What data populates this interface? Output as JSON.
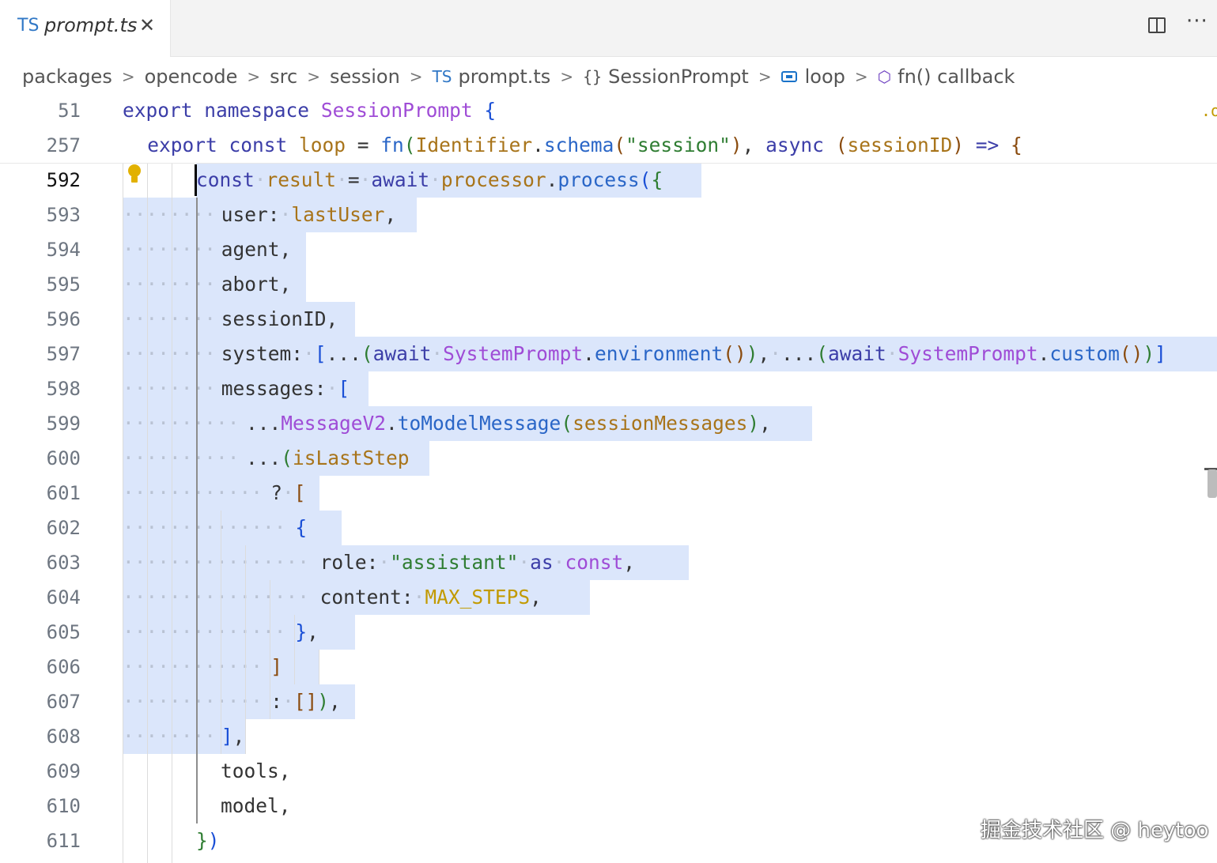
{
  "tab": {
    "lang_badge": "TS",
    "file_name": "prompt.ts",
    "close_glyph": "✕"
  },
  "toolbar": {
    "split_icon": "split-editor-icon",
    "more_glyph": "···"
  },
  "breadcrumb": {
    "items": [
      "packages",
      "opencode",
      "src",
      "session",
      "prompt.ts",
      "SessionPrompt",
      "loop",
      "fn() callback"
    ],
    "ts_badge": "TS",
    "braces_glyph": "{}"
  },
  "sticky": [
    {
      "line_number": "51",
      "tokens": [
        [
          "kw",
          "export"
        ],
        [
          "pn",
          " "
        ],
        [
          "kw",
          "namespace"
        ],
        [
          "pn",
          " "
        ],
        [
          "ty",
          "SessionPrompt"
        ],
        [
          "pn",
          " "
        ],
        [
          "b1",
          "{"
        ]
      ]
    },
    {
      "line_number": "257",
      "tokens": [
        [
          "kw",
          "export"
        ],
        [
          "pn",
          " "
        ],
        [
          "kw",
          "const"
        ],
        [
          "pn",
          " "
        ],
        [
          "va",
          "loop"
        ],
        [
          "pn",
          " = "
        ],
        [
          "fn",
          "fn"
        ],
        [
          "b2",
          "("
        ],
        [
          "va",
          "Identifier"
        ],
        [
          "pn",
          "."
        ],
        [
          "fn",
          "schema"
        ],
        [
          "b3",
          "("
        ],
        [
          "st",
          "\"session\""
        ],
        [
          "b3",
          ")"
        ],
        [
          "pn",
          ", "
        ],
        [
          "kw",
          "async"
        ],
        [
          "pn",
          " "
        ],
        [
          "b3",
          "("
        ],
        [
          "pa",
          "sessionID"
        ],
        [
          "b3",
          ")"
        ],
        [
          "pn",
          " "
        ],
        [
          "kw",
          "=>"
        ],
        [
          "pn",
          " "
        ],
        [
          "b3",
          "{"
        ]
      ]
    }
  ],
  "lines": [
    {
      "line_number": "592",
      "active": true,
      "tokens": [
        [
          "kw",
          "const"
        ],
        [
          "dot",
          "·"
        ],
        [
          "va",
          "result"
        ],
        [
          "dot",
          "·"
        ],
        [
          "pn",
          "="
        ],
        [
          "dot",
          "·"
        ],
        [
          "kw",
          "await"
        ],
        [
          "dot",
          "·"
        ],
        [
          "va",
          "processor"
        ],
        [
          "pn",
          "."
        ],
        [
          "fn",
          "process"
        ],
        [
          "b1",
          "("
        ],
        [
          "b2",
          "{"
        ]
      ]
    },
    {
      "line_number": "593",
      "tokens": [
        [
          "pn",
          "user:"
        ],
        [
          "dot",
          "·"
        ],
        [
          "va",
          "lastUser"
        ],
        [
          "pn",
          ","
        ]
      ]
    },
    {
      "line_number": "594",
      "tokens": [
        [
          "pn",
          "agent,"
        ]
      ]
    },
    {
      "line_number": "595",
      "tokens": [
        [
          "pn",
          "abort,"
        ]
      ]
    },
    {
      "line_number": "596",
      "tokens": [
        [
          "pn",
          "sessionID,"
        ]
      ]
    },
    {
      "line_number": "597",
      "tokens": [
        [
          "pn",
          "system:"
        ],
        [
          "dot",
          "·"
        ],
        [
          "b1",
          "["
        ],
        [
          "pn",
          "..."
        ],
        [
          "b2",
          "("
        ],
        [
          "kw",
          "await"
        ],
        [
          "dot",
          "·"
        ],
        [
          "ty",
          "SystemPrompt"
        ],
        [
          "pn",
          "."
        ],
        [
          "fn",
          "environment"
        ],
        [
          "b3",
          "()"
        ],
        [
          "b2",
          ")"
        ],
        [
          "pn",
          ","
        ],
        [
          "dot",
          "·"
        ],
        [
          "pn",
          "..."
        ],
        [
          "b2",
          "("
        ],
        [
          "kw",
          "await"
        ],
        [
          "dot",
          "·"
        ],
        [
          "ty",
          "SystemPrompt"
        ],
        [
          "pn",
          "."
        ],
        [
          "fn",
          "custom"
        ],
        [
          "b3",
          "()"
        ],
        [
          "b2",
          ")"
        ],
        [
          "b1",
          "]"
        ]
      ]
    },
    {
      "line_number": "598",
      "tokens": [
        [
          "pn",
          "messages:"
        ],
        [
          "dot",
          "·"
        ],
        [
          "b1",
          "["
        ]
      ]
    },
    {
      "line_number": "599",
      "tokens": [
        [
          "pn",
          "..."
        ],
        [
          "ty",
          "MessageV2"
        ],
        [
          "pn",
          "."
        ],
        [
          "fn",
          "toModelMessage"
        ],
        [
          "b2",
          "("
        ],
        [
          "va",
          "sessionMessages"
        ],
        [
          "b2",
          ")"
        ],
        [
          "pn",
          ","
        ]
      ]
    },
    {
      "line_number": "600",
      "tokens": [
        [
          "pn",
          "..."
        ],
        [
          "b2",
          "("
        ],
        [
          "va",
          "isLastStep"
        ]
      ]
    },
    {
      "line_number": "601",
      "tokens": [
        [
          "pn",
          "?"
        ],
        [
          "dot",
          "·"
        ],
        [
          "b3",
          "["
        ]
      ]
    },
    {
      "line_number": "602",
      "tokens": [
        [
          "b1",
          "{"
        ]
      ]
    },
    {
      "line_number": "603",
      "tokens": [
        [
          "pn",
          "role:"
        ],
        [
          "dot",
          "·"
        ],
        [
          "st",
          "\"assistant\""
        ],
        [
          "dot",
          "·"
        ],
        [
          "kw",
          "as"
        ],
        [
          "dot",
          "·"
        ],
        [
          "ty",
          "const"
        ],
        [
          "pn",
          ","
        ]
      ]
    },
    {
      "line_number": "604",
      "tokens": [
        [
          "pn",
          "content:"
        ],
        [
          "dot",
          "·"
        ],
        [
          "co",
          "MAX_STEPS"
        ],
        [
          "pn",
          ","
        ]
      ]
    },
    {
      "line_number": "605",
      "tokens": [
        [
          "b1",
          "}"
        ],
        [
          "pn",
          ","
        ]
      ]
    },
    {
      "line_number": "606",
      "tokens": [
        [
          "b3",
          "]"
        ]
      ]
    },
    {
      "line_number": "607",
      "tokens": [
        [
          "pn",
          ":"
        ],
        [
          "dot",
          "·"
        ],
        [
          "b3",
          "[]"
        ],
        [
          "b2",
          ")"
        ],
        [
          "pn",
          ","
        ]
      ]
    },
    {
      "line_number": "608",
      "tokens": [
        [
          "b1",
          "]"
        ],
        [
          "pn",
          ","
        ]
      ]
    },
    {
      "line_number": "609",
      "tokens": [
        [
          "pn",
          "tools,"
        ]
      ]
    },
    {
      "line_number": "610",
      "tokens": [
        [
          "pn",
          "model,"
        ]
      ]
    },
    {
      "line_number": "611",
      "tokens": [
        [
          "b2",
          "}"
        ],
        [
          "b1",
          ")"
        ]
      ]
    }
  ],
  "minimap_fragment": ".o",
  "watermark": "掘金技术社区 @ heytoo",
  "colors": {
    "keyword": "#3c3ea8",
    "type": "#9f4cd6",
    "function": "#2a66c7",
    "variable": "#a8741a",
    "string": "#2f7d32",
    "selection": "#dbe6fb",
    "ts_blue": "#3178c6"
  }
}
